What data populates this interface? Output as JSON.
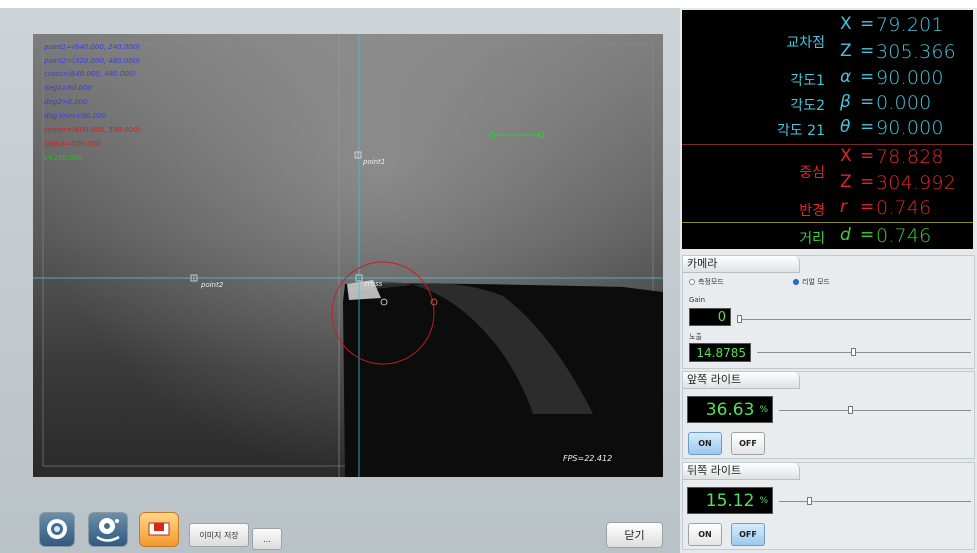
{
  "overlay": {
    "lines": [
      {
        "text": "point1=(640.000, 240.000)",
        "color": "blue"
      },
      {
        "text": "point2=(320.000, 480.000)",
        "color": "blue"
      },
      {
        "text": "cross=(640.000, 480.000)",
        "color": "blue"
      },
      {
        "text": "deg1=90.000",
        "color": "blue"
      },
      {
        "text": "deg2=0.000",
        "color": "blue"
      },
      {
        "text": "deg lines=90.000",
        "color": "blue"
      },
      {
        "text": "center=(600.000, 530.000)",
        "color": "red"
      },
      {
        "text": "radius=100.000",
        "color": "red"
      },
      {
        "text": "L=100.000",
        "color": "green"
      }
    ],
    "point1_label": "point1",
    "point2_label": "point2",
    "cross_label": "cross",
    "fps": "FPS=22.412"
  },
  "readout": {
    "intersection_label": "교차점",
    "x_var": "X",
    "z_var": "Z",
    "eq": "=",
    "intersection_x": "79.201",
    "intersection_z": "305.366",
    "angle1_label": "각도1",
    "alpha_var": "α",
    "angle1_value": "90.000",
    "angle2_label": "각도2",
    "beta_var": "β",
    "angle2_value": "0.000",
    "angle21_label": "각도 21",
    "theta_var": "θ",
    "angle21_value": "90.000",
    "center_label": "중심",
    "center_x": "78.828",
    "center_z": "304.992",
    "radius_label": "반경",
    "r_var": "r",
    "radius_value": "0.746",
    "distance_label": "거리",
    "d_var": "d",
    "distance_value": "0.746",
    "colors": {
      "cyan": "#46c6dc",
      "red": "#e0262a",
      "green": "#3fcf3a"
    }
  },
  "camera": {
    "title": "카메라",
    "mode_measure": "측정모드",
    "mode_real": "리얼 모드",
    "selected_mode": "리얼 모드",
    "gain_label": "Gain",
    "gain_value": "0",
    "exposure_label": "노출",
    "exposure_value": "14.8785",
    "gain_slider_fraction": 0.0,
    "exposure_slider_fraction": 0.45
  },
  "front_light": {
    "title": "앞쪽 라이트",
    "value": "36.63",
    "unit": "%",
    "slider_fraction": 0.37,
    "on_label": "ON",
    "off_label": "OFF",
    "state": "ON"
  },
  "back_light": {
    "title": "뒤쪽 라이트",
    "value": "15.12",
    "unit": "%",
    "slider_fraction": 0.15,
    "on_label": "ON",
    "off_label": "OFF",
    "state": "OFF"
  },
  "toolbar": {
    "save_image_label": "이미지 저장",
    "more_label": "...",
    "close_label": "닫기",
    "icons": [
      "camera-lens-icon",
      "camera-settings-icon",
      "measure-tool-icon"
    ]
  }
}
